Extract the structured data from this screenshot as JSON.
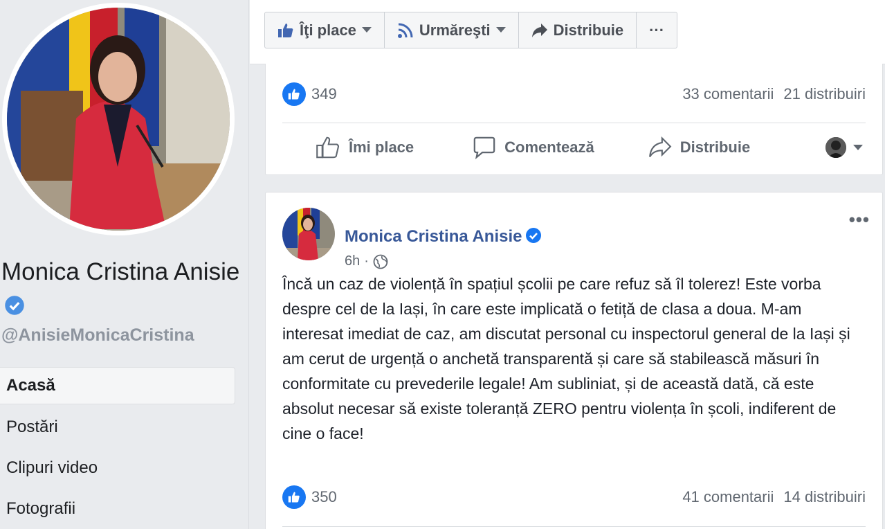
{
  "profile": {
    "name": "Monica Cristina Anisie",
    "handle": "@AnisieMonicaCristina"
  },
  "nav": {
    "items": [
      {
        "label": "Acasă",
        "active": true
      },
      {
        "label": "Postări"
      },
      {
        "label": "Clipuri video"
      },
      {
        "label": "Fotografii"
      }
    ]
  },
  "page_actions": {
    "like_label": "Îţi place",
    "follow_label": "Urmăreşti",
    "share_label": "Distribuie",
    "more_label": "···"
  },
  "post1": {
    "like_count": "349",
    "comments": "33 comentarii",
    "shares": "21 distribuiri",
    "action_like": "Îmi place",
    "action_comment": "Comentează",
    "action_share": "Distribuie"
  },
  "post2": {
    "author": "Monica Cristina Anisie",
    "time": "6h",
    "separator": "·",
    "more": "•••",
    "text": "Încă un caz de violență în spațiul școlii pe care refuz să îl tolerez! Este vorba despre cel de la Iași, în care este implicată o fetiță de clasa a doua. M-am interesat imediat de caz, am discutat personal cu inspectorul general de la Iași și am cerut de urgență o anchetă transparentă și care să stabilească măsuri în conformitate cu prevederile legale! Am subliniat, și de această dată, că este absolut necesar să existe toleranță ZERO pentru violența în școli, indiferent de cine o face!",
    "like_count": "350",
    "comments": "41 comentarii",
    "shares": "14 distribuiri"
  },
  "colors": {
    "brand_blue": "#1877f2",
    "link_blue": "#385898",
    "page_bg": "#e9ebee"
  }
}
